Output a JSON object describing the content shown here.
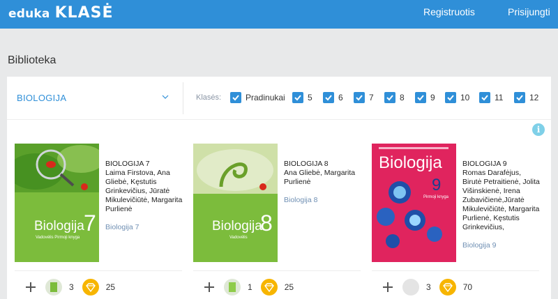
{
  "header": {
    "logo_eduka": "eduka",
    "logo_klase": "KLASĖ",
    "register": "Registruotis",
    "login": "Prisijungti"
  },
  "page": {
    "title": "Biblioteka"
  },
  "filters": {
    "subject": "BIOLOGIJA",
    "classes_label": "Klasės:",
    "classes": [
      {
        "label": "Pradinukai",
        "checked": true
      },
      {
        "label": "5",
        "checked": true
      },
      {
        "label": "6",
        "checked": true
      },
      {
        "label": "7",
        "checked": true
      },
      {
        "label": "8",
        "checked": true
      },
      {
        "label": "9",
        "checked": true
      },
      {
        "label": "10",
        "checked": true
      },
      {
        "label": "11",
        "checked": true
      },
      {
        "label": "12",
        "checked": true
      }
    ]
  },
  "info": "i",
  "books": [
    {
      "title": "BIOLOGIJA 7",
      "authors": "Laima Firstova, Ana Gliebė, Kęstutis Grinkevičius, Jūratė Mikulevičiūtė, Margarita Purlienė",
      "link": "Biologija 7",
      "cover_text": "Biologija",
      "cover_number": "7",
      "cover_sub": "Vadovėlis  Pirmoji knyga",
      "count": "3",
      "points": "25"
    },
    {
      "title": "BIOLOGIJA 8",
      "authors": "Ana Gliebė, Margarita Purlienė",
      "link": "Biologija 8",
      "cover_text": "Biologija",
      "cover_number": "8",
      "cover_sub": "Vadovėlis",
      "count": "1",
      "points": "25"
    },
    {
      "title": "BIOLOGIJA 9",
      "authors": "Romas Darafėjus, Birutė Petraitienė, Jolita Višinskienė, Irena Zubavičienė,Jūratė Mikulevičiūtė, Margarita Purlienė, Kęstutis Grinkevičius,",
      "link": "Biologija 9",
      "cover_text": "Biologija",
      "cover_number": "9",
      "cover_sub": "Pirmoji knyga",
      "count": "3",
      "points": "70"
    }
  ],
  "colors": {
    "header": "#2f8fd8",
    "accent": "#2f8fd8",
    "gem": "#f7b500",
    "cover_green": "#7cbc3c",
    "cover_pink": "#e0245e"
  }
}
